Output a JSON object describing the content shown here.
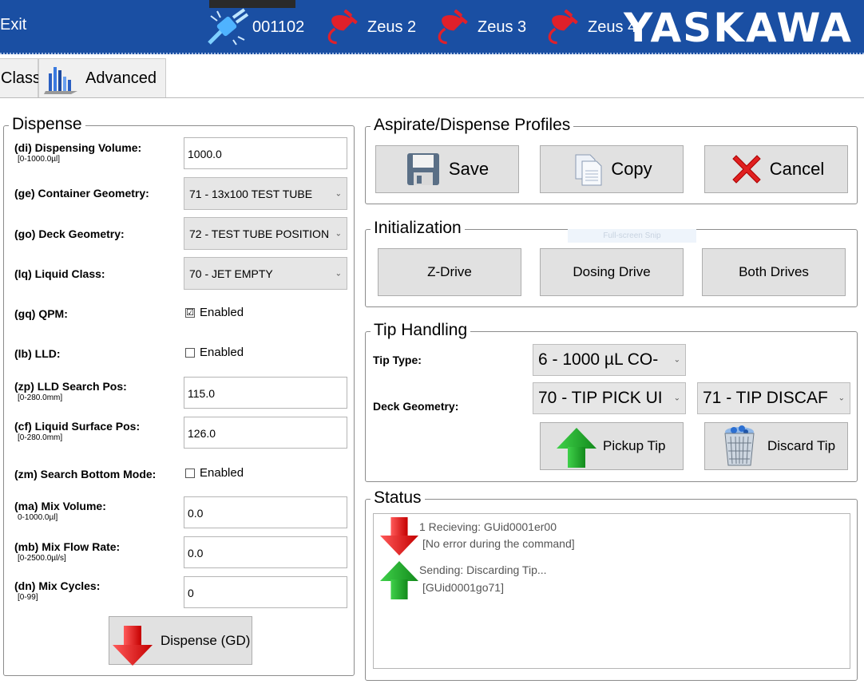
{
  "header": {
    "exit_label": "Exit",
    "devices": [
      {
        "name": "001102",
        "icon": "connected-plug-icon",
        "color": "#4fb3ff"
      },
      {
        "name": "Zeus 2",
        "icon": "disconnected-plug-icon",
        "color": "#e0202a"
      },
      {
        "name": "Zeus 3",
        "icon": "disconnected-plug-icon",
        "color": "#e0202a"
      },
      {
        "name": "Zeus 4",
        "icon": "disconnected-plug-icon",
        "color": "#e0202a"
      }
    ],
    "logo": "YASKAWA",
    "bar_color": "#1a4fa3"
  },
  "tabs": [
    {
      "label": "Class"
    },
    {
      "label": "Advanced",
      "icon": "bar-chart-icon"
    }
  ],
  "dispense": {
    "title": "Dispense",
    "fields": {
      "di": {
        "label": "(di) Dispensing Volume:",
        "range": "[0-1000.0µl]",
        "value": "1000.0"
      },
      "ge": {
        "label": "(ge) Container Geometry:",
        "value": "71 - 13x100 TEST TUBE"
      },
      "go": {
        "label": "(go) Deck Geometry:",
        "value": "72 - TEST TUBE POSITION"
      },
      "lq": {
        "label": "(lq) Liquid Class:",
        "value": "70 - JET EMPTY"
      },
      "gq": {
        "label": "(gq) QPM:",
        "check_label": "Enabled",
        "checked": "☑"
      },
      "lb": {
        "label": "(lb) LLD:",
        "check_label": "Enabled",
        "checked": ""
      },
      "zp": {
        "label": "(zp) LLD Search Pos:",
        "range": "[0-280.0mm]",
        "value": "115.0"
      },
      "cf": {
        "label": "(cf) Liquid Surface Pos:",
        "range": "[0-280.0mm]",
        "value": "126.0"
      },
      "zm": {
        "label": "(zm) Search Bottom Mode:",
        "check_label": "Enabled",
        "checked": ""
      },
      "ma": {
        "label": "(ma) Mix Volume:",
        "range": "0-1000.0µl]",
        "value": "0.0"
      },
      "mb": {
        "label": "(mb) Mix Flow Rate:",
        "range": "[0-2500.0µl/s]",
        "value": "0.0"
      },
      "dn": {
        "label": "(dn) Mix Cycles:",
        "range": "[0-99]",
        "value": "0"
      }
    },
    "dispense_button": "Dispense (GD)"
  },
  "profiles": {
    "title": "Aspirate/Dispense Profiles",
    "save": "Save",
    "copy": "Copy",
    "cancel": "Cancel"
  },
  "initialization": {
    "title": "Initialization",
    "z_drive": "Z-Drive",
    "dosing_drive": "Dosing Drive",
    "both_drives": "Both Drives",
    "overlay": "Full-screen Snip"
  },
  "tip_handling": {
    "title": "Tip Handling",
    "tip_type_label": "Tip Type:",
    "tip_type_value": "6 - 1000 µL CO-",
    "deck_geometry_label": "Deck Geometry:",
    "pick_value": "70 - TIP PICK UI",
    "discard_value": "71 - TIP DISCAF",
    "pickup_button": "Pickup Tip",
    "discard_button": "Discard Tip"
  },
  "status": {
    "title": "Status",
    "entries": [
      {
        "line1": "1 Recieving: GUid0001er00",
        "line2": "[No error during the command]",
        "icon": "red-down-arrow-icon"
      },
      {
        "line1": "Sending: Discarding Tip...",
        "line2": "[GUid0001go71]",
        "icon": "green-up-arrow-icon"
      }
    ]
  }
}
